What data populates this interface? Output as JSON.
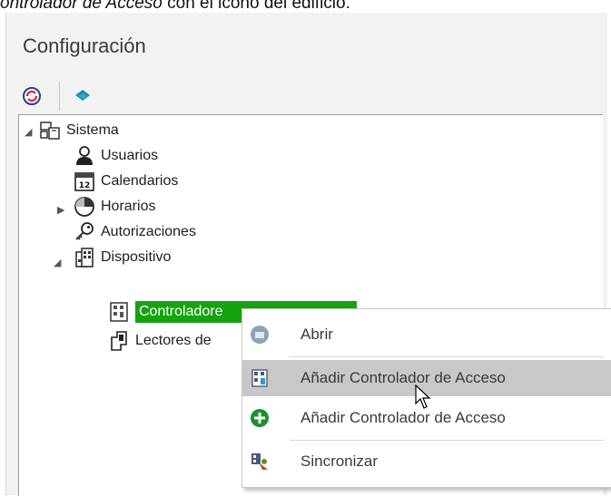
{
  "caption": {
    "italic": "ontrolador de Acceso",
    "rest": " con el icono del edificio."
  },
  "panel": {
    "title": "Configuración"
  },
  "tree": {
    "root": "Sistema",
    "items": {
      "usuarios": "Usuarios",
      "calendarios": "Calendarios",
      "horarios": "Horarios",
      "autorizaciones": "Autorizaciones",
      "dispositivo": "Dispositivo",
      "controladores": "Controladore",
      "lectores": "Lectores de"
    },
    "calendar_day": "12"
  },
  "context_menu": {
    "items": [
      {
        "label": "Abrir",
        "icon": "open-icon"
      },
      {
        "label": "Añadir Controlador de Acceso",
        "icon": "building-controller-icon",
        "hover": true
      },
      {
        "label": "Añadir Controlador de Acceso",
        "icon": "green-plus-icon"
      },
      {
        "label": "Sincronizar",
        "icon": "sync-icon"
      }
    ]
  },
  "colors": {
    "selection": "#15a30f",
    "menu_hover": "#c8c8c8",
    "add_icon": "#1e8f2e"
  }
}
